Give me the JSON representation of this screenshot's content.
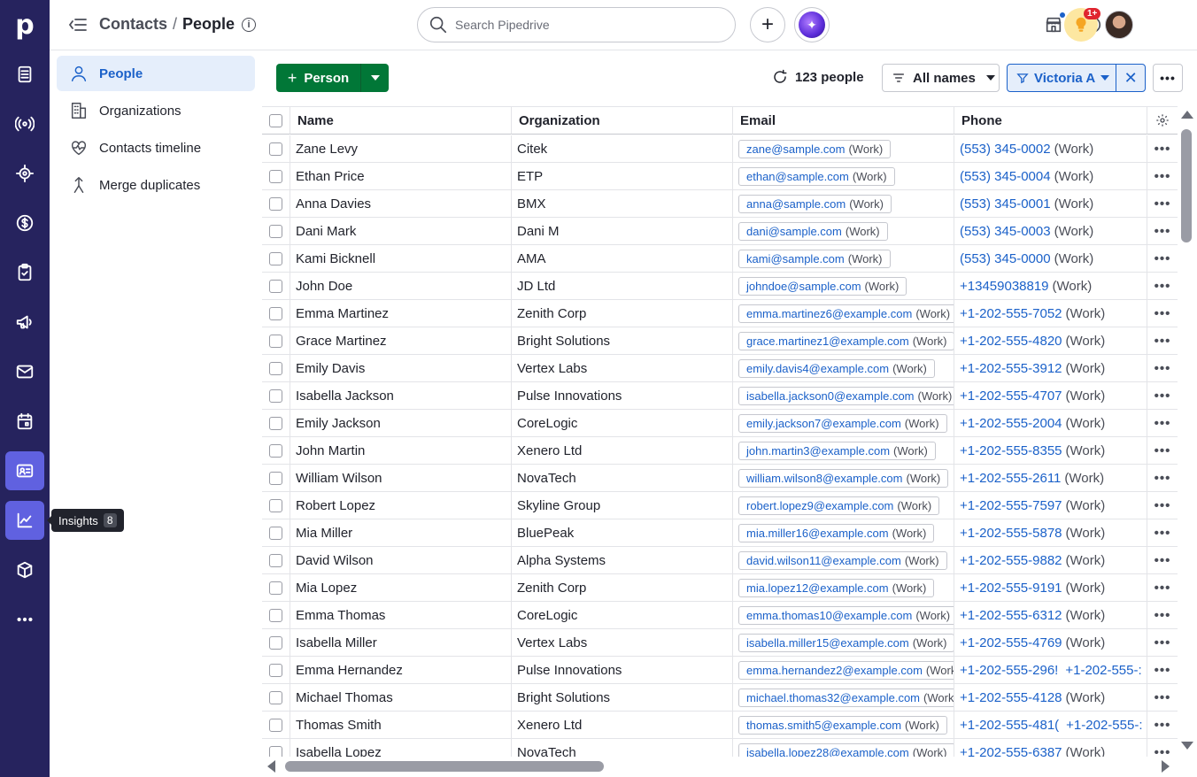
{
  "app": {
    "logo": "p"
  },
  "rail": {
    "items": [
      {
        "name": "deals-icon"
      },
      {
        "name": "leads-icon"
      },
      {
        "name": "projects-icon"
      },
      {
        "name": "money-icon"
      },
      {
        "name": "activities-icon"
      },
      {
        "name": "campaigns-icon"
      },
      {
        "name": "mail-icon"
      },
      {
        "name": "calendar-icon"
      },
      {
        "name": "contacts-icon"
      },
      {
        "name": "insights-icon"
      },
      {
        "name": "products-icon"
      },
      {
        "name": "more-icon"
      }
    ],
    "tooltip": {
      "label": "Insights",
      "count": "8"
    }
  },
  "header": {
    "breadcrumb_parent": "Contacts",
    "breadcrumb_sep": "/",
    "breadcrumb_current": "People",
    "search_placeholder": "Search Pipedrive",
    "notification_badge": "1+"
  },
  "sidenav": {
    "items": [
      {
        "label": "People"
      },
      {
        "label": "Organizations"
      },
      {
        "label": "Contacts timeline"
      },
      {
        "label": "Merge duplicates"
      }
    ]
  },
  "toolbar": {
    "add_label": "Person",
    "count_label": "123 people",
    "filter_label": "All names",
    "owner_filter": "Victoria A"
  },
  "table": {
    "columns": [
      "Name",
      "Organization",
      "Email",
      "Phone"
    ],
    "rows": [
      {
        "name": "Zane Levy",
        "org": "Citek",
        "email": "zane@sample.com",
        "email_label": "(Work)",
        "phone": "(553) 345-0002",
        "phone_label": "(Work)"
      },
      {
        "name": "Ethan Price",
        "org": "ETP",
        "email": "ethan@sample.com",
        "email_label": "(Work)",
        "phone": "(553) 345-0004",
        "phone_label": "(Work)"
      },
      {
        "name": "Anna Davies",
        "org": "BMX",
        "email": "anna@sample.com",
        "email_label": "(Work)",
        "phone": "(553) 345-0001",
        "phone_label": "(Work)"
      },
      {
        "name": "Dani Mark",
        "org": "Dani M",
        "email": "dani@sample.com",
        "email_label": "(Work)",
        "phone": "(553) 345-0003",
        "phone_label": "(Work)"
      },
      {
        "name": "Kami Bicknell",
        "org": "AMA",
        "email": "kami@sample.com",
        "email_label": "(Work)",
        "phone": "(553) 345-0000",
        "phone_label": "(Work)"
      },
      {
        "name": "John Doe",
        "org": "JD Ltd",
        "email": "johndoe@sample.com",
        "email_label": "(Work)",
        "phone": "+13459038819",
        "phone_label": "(Work)"
      },
      {
        "name": "Emma Martinez",
        "org": "Zenith Corp",
        "email": "emma.martinez6@example.com",
        "email_label": "(Work)",
        "phone": "+1-202-555-7052",
        "phone_label": "(Work)"
      },
      {
        "name": "Grace Martinez",
        "org": "Bright Solutions",
        "email": "grace.martinez1@example.com",
        "email_label": "(Work)",
        "phone": "+1-202-555-4820",
        "phone_label": "(Work)"
      },
      {
        "name": "Emily Davis",
        "org": "Vertex Labs",
        "email": "emily.davis4@example.com",
        "email_label": "(Work)",
        "phone": "+1-202-555-3912",
        "phone_label": "(Work)"
      },
      {
        "name": "Isabella Jackson",
        "org": "Pulse Innovations",
        "email": "isabella.jackson0@example.com",
        "email_label": "(Work)",
        "phone": "+1-202-555-4707",
        "phone_label": "(Work)"
      },
      {
        "name": "Emily Jackson",
        "org": "CoreLogic",
        "email": "emily.jackson7@example.com",
        "email_label": "(Work)",
        "phone": "+1-202-555-2004",
        "phone_label": "(Work)"
      },
      {
        "name": "John Martin",
        "org": "Xenero Ltd",
        "email": "john.martin3@example.com",
        "email_label": "(Work)",
        "phone": "+1-202-555-8355",
        "phone_label": "(Work)"
      },
      {
        "name": "William Wilson",
        "org": "NovaTech",
        "email": "william.wilson8@example.com",
        "email_label": "(Work)",
        "phone": "+1-202-555-2611",
        "phone_label": "(Work)"
      },
      {
        "name": "Robert Lopez",
        "org": "Skyline Group",
        "email": "robert.lopez9@example.com",
        "email_label": "(Work)",
        "phone": "+1-202-555-7597",
        "phone_label": "(Work)"
      },
      {
        "name": "Mia Miller",
        "org": "BluePeak",
        "email": "mia.miller16@example.com",
        "email_label": "(Work)",
        "phone": "+1-202-555-5878",
        "phone_label": "(Work)"
      },
      {
        "name": "David Wilson",
        "org": "Alpha Systems",
        "email": "david.wilson11@example.com",
        "email_label": "(Work)",
        "phone": "+1-202-555-9882",
        "phone_label": "(Work)"
      },
      {
        "name": "Mia Lopez",
        "org": "Zenith Corp",
        "email": "mia.lopez12@example.com",
        "email_label": "(Work)",
        "phone": "+1-202-555-9191",
        "phone_label": "(Work)"
      },
      {
        "name": "Emma Thomas",
        "org": "CoreLogic",
        "email": "emma.thomas10@example.com",
        "email_label": "(Work)",
        "phone": "+1-202-555-6312",
        "phone_label": "(Work)"
      },
      {
        "name": "Isabella Miller",
        "org": "Vertex Labs",
        "email": "isabella.miller15@example.com",
        "email_label": "(Work)",
        "phone": "+1-202-555-4769",
        "phone_label": "(Work)"
      },
      {
        "name": "Emma Hernandez",
        "org": "Pulse Innovations",
        "email": "emma.hernandez2@example.com",
        "email_label": "(Work",
        "phone": "+1-202-555-296!",
        "phone_label": "+1-202-555-:"
      },
      {
        "name": "Michael Thomas",
        "org": "Bright Solutions",
        "email": "michael.thomas32@example.com",
        "email_label": "(Work",
        "phone": "+1-202-555-4128",
        "phone_label": "(Work)"
      },
      {
        "name": "Thomas Smith",
        "org": "Xenero Ltd",
        "email": "thomas.smith5@example.com",
        "email_label": "(Work)",
        "phone": "+1-202-555-481(",
        "phone_label": "+1-202-555-:"
      },
      {
        "name": "Isabella Lopez",
        "org": "NovaTech",
        "email": "isabella.lopez28@example.com",
        "email_label": "(Work)",
        "phone": "+1-202-555-6387",
        "phone_label": "(Work)"
      }
    ]
  },
  "colors": {
    "rail": "#26235e",
    "accent": "#6061e0",
    "primary_green": "#017737",
    "link": "#1b61c9"
  }
}
